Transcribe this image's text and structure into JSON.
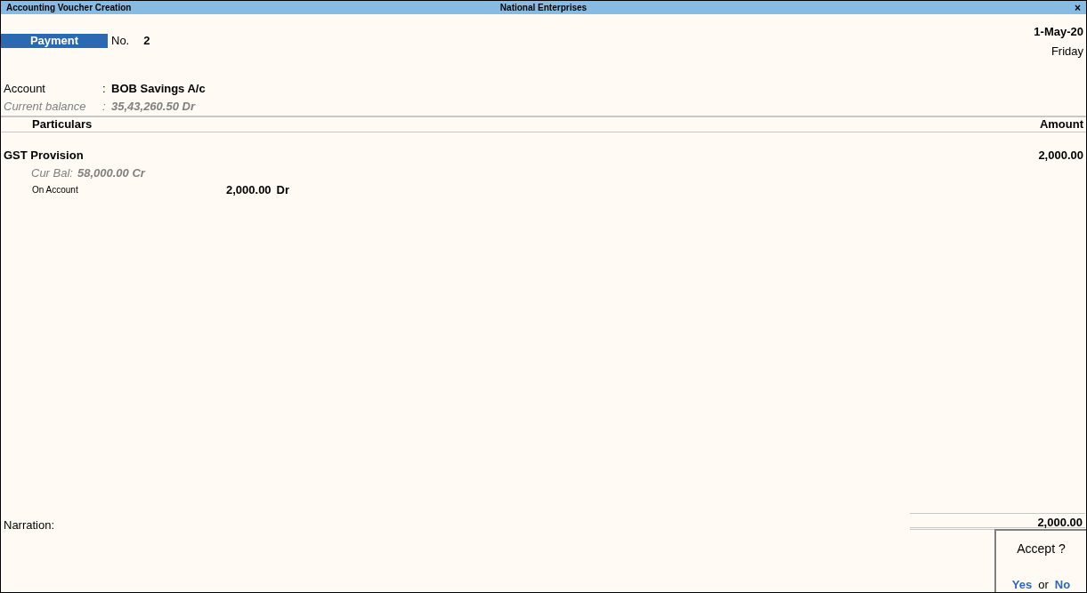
{
  "window": {
    "title": "Accounting Voucher Creation",
    "company": "National Enterprises",
    "close": "×"
  },
  "voucher": {
    "type": "Payment",
    "no_label": "No.",
    "number": "2",
    "date": "1-May-20",
    "day": "Friday"
  },
  "account": {
    "label": "Account",
    "sep": ":",
    "value": "BOB Savings A/c"
  },
  "balance": {
    "label": "Current balance",
    "sep": ":",
    "value": "35,43,260.50 Dr"
  },
  "columns": {
    "particulars": "Particulars",
    "amount": "Amount"
  },
  "entries": [
    {
      "ledger": "GST Provision",
      "amount": "2,000.00",
      "cur_bal_label": "Cur Bal:",
      "cur_bal": "58,000.00 Cr",
      "bill": "On Account",
      "bill_amount": "2,000.00",
      "bill_side": "Dr"
    }
  ],
  "narration": {
    "label": "Narration:"
  },
  "total": "2,000.00",
  "dialog": {
    "question": "Accept ?",
    "yes": "Yes",
    "or": "or",
    "no": "No"
  }
}
